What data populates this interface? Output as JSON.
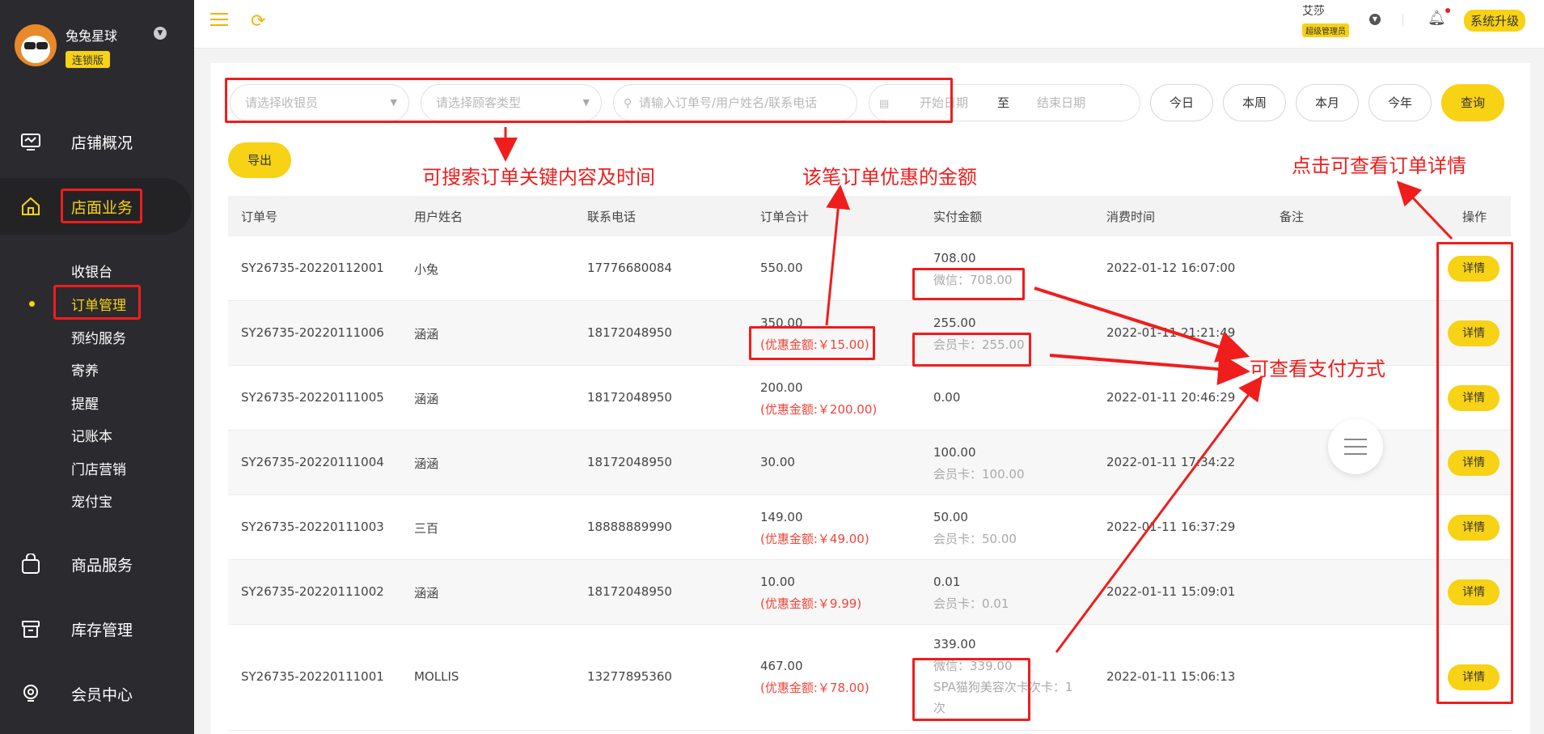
{
  "sidebar": {
    "store_name": "兔兔星球",
    "store_badge": "连锁版",
    "menu": [
      {
        "label": "店铺概况",
        "icon": "monitor-icon"
      },
      {
        "label": "店面业务",
        "icon": "home-icon"
      },
      {
        "label": "商品服务",
        "icon": "bag-icon"
      },
      {
        "label": "库存管理",
        "icon": "box-icon"
      },
      {
        "label": "会员中心",
        "icon": "user-icon"
      }
    ],
    "submenu": [
      "收银台",
      "订单管理",
      "预约服务",
      "寄养",
      "提醒",
      "记账本",
      "门店营销",
      "宠付宝"
    ]
  },
  "topbar": {
    "user_name": "艾莎",
    "user_role": "超级管理员",
    "upgrade_label": "系统升级"
  },
  "filters": {
    "cashier_placeholder": "请选择收银员",
    "customer_type_placeholder": "请选择顾客类型",
    "search_placeholder": "请输入订单号/用户姓名/联系电话",
    "start_date_placeholder": "开始日期",
    "to_label": "至",
    "end_date_placeholder": "结束日期",
    "quick_ranges": [
      "今日",
      "本周",
      "本月",
      "今年"
    ],
    "query_label": "查询",
    "export_label": "导出"
  },
  "table": {
    "columns": [
      "订单号",
      "用户姓名",
      "联系电话",
      "订单合计",
      "实付金额",
      "消费时间",
      "备注",
      "操作"
    ],
    "detail_label": "详情",
    "rows": [
      {
        "order_no": "SY26735-20220112001",
        "name": "小兔",
        "phone": "17776680084",
        "total": "550.00",
        "discount": "",
        "paid": "708.00",
        "pay_methods": [
          "微信：708.00"
        ],
        "time": "2022-01-12 16:07:00",
        "remark": ""
      },
      {
        "order_no": "SY26735-20220111006",
        "name": "涵涵",
        "phone": "18172048950",
        "total": "350.00",
        "discount": "(优惠金额:￥15.00)",
        "paid": "255.00",
        "pay_methods": [
          "会员卡：255.00"
        ],
        "time": "2022-01-11 21:21:49",
        "remark": ""
      },
      {
        "order_no": "SY26735-20220111005",
        "name": "涵涵",
        "phone": "18172048950",
        "total": "200.00",
        "discount": "(优惠金额:￥200.00)",
        "paid": "0.00",
        "pay_methods": [],
        "time": "2022-01-11 20:46:29",
        "remark": ""
      },
      {
        "order_no": "SY26735-20220111004",
        "name": "涵涵",
        "phone": "18172048950",
        "total": "30.00",
        "discount": "",
        "paid": "100.00",
        "pay_methods": [
          "会员卡：100.00"
        ],
        "time": "2022-01-11 17:34:22",
        "remark": ""
      },
      {
        "order_no": "SY26735-20220111003",
        "name": "三百",
        "phone": "18888889990",
        "total": "149.00",
        "discount": "(优惠金额:￥49.00)",
        "paid": "50.00",
        "pay_methods": [
          "会员卡：50.00"
        ],
        "time": "2022-01-11 16:37:29",
        "remark": ""
      },
      {
        "order_no": "SY26735-20220111002",
        "name": "涵涵",
        "phone": "18172048950",
        "total": "10.00",
        "discount": "(优惠金额:￥9.99)",
        "paid": "0.01",
        "pay_methods": [
          "会员卡：0.01"
        ],
        "time": "2022-01-11 15:09:01",
        "remark": ""
      },
      {
        "order_no": "SY26735-20220111001",
        "name": "MOLLIS",
        "phone": "13277895360",
        "total": "467.00",
        "discount": "(优惠金额:￥78.00)",
        "paid": "339.00",
        "pay_methods": [
          "微信：339.00",
          "SPA猫狗美容次卡次卡：1",
          "次"
        ],
        "time": "2022-01-11 15:06:13",
        "remark": ""
      }
    ]
  },
  "annotations": {
    "search": "可搜索订单关键内容及时间",
    "discount": "该笔订单优惠的金额",
    "detail": "点击可查看订单详情",
    "payment": "可查看支付方式"
  },
  "colors": {
    "accent": "#f7d215",
    "sidebar_bg": "#2b2b2f",
    "annotation": "#f01d1d",
    "discount_text": "#f0453a"
  }
}
